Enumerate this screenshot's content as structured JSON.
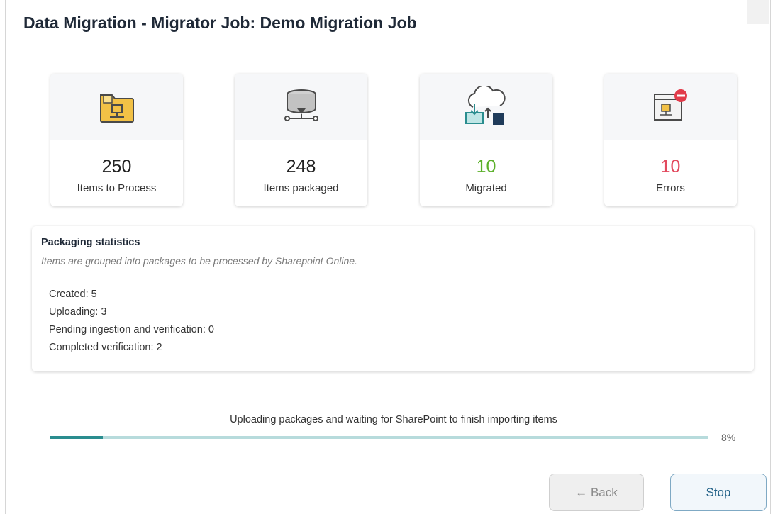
{
  "title": "Data Migration - Migrator Job: Demo Migration Job",
  "cards": [
    {
      "value": "250",
      "label": "Items to Process",
      "icon": "folder-icon"
    },
    {
      "value": "248",
      "label": "Items packaged",
      "icon": "database-icon"
    },
    {
      "value": "10",
      "label": "Migrated",
      "icon": "cloud-upload-icon",
      "color": "#5bb02a"
    },
    {
      "value": "10",
      "label": "Errors",
      "icon": "error-window-icon",
      "color": "#e24a5e"
    }
  ],
  "packaging": {
    "heading": "Packaging statistics",
    "subtitle": "Items are grouped into packages to be processed by Sharepoint Online.",
    "lines": [
      "Created: 5",
      "Uploading: 3",
      "Pending ingestion and verification: 0",
      "Completed verification: 2"
    ]
  },
  "progress": {
    "status_text": "Uploading packages and waiting for SharePoint to finish importing items",
    "percent_label": "8%",
    "fraction": 0.08,
    "track_color": "#b7dbdc",
    "fill_color": "#2a8d8f"
  },
  "buttons": {
    "back_label": "← Back",
    "stop_label": "Stop"
  }
}
